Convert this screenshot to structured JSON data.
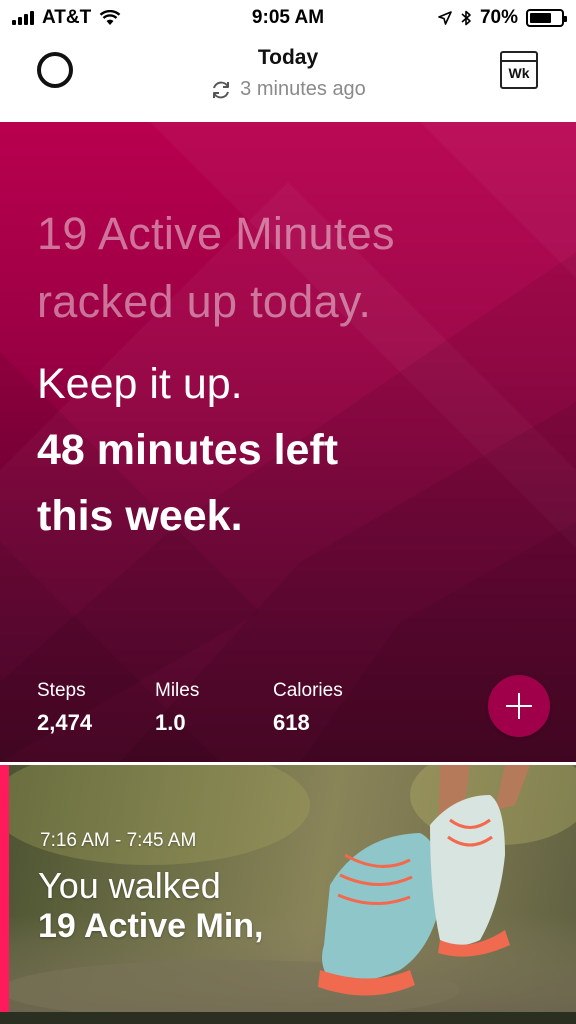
{
  "status_bar": {
    "carrier": "AT&T",
    "time": "9:05 AM",
    "battery": "70%",
    "battery_level": 0.7,
    "icons": [
      "signal-icon",
      "wifi-icon",
      "location-icon",
      "bluetooth-icon",
      "battery-icon"
    ]
  },
  "header": {
    "title": "Today",
    "sync_text": "3 minutes ago",
    "week_button": "Wk"
  },
  "hero": {
    "line1": "19 Active Minutes",
    "line2": "racked up today.",
    "encourage": "Keep it up.",
    "bold_line1": "48 minutes left",
    "bold_line2": "this week."
  },
  "stats": [
    {
      "label": "Steps",
      "value": "2,474"
    },
    {
      "label": "Miles",
      "value": "1.0"
    },
    {
      "label": "Calories",
      "value": "618"
    }
  ],
  "activity": {
    "time_range": "7:16 AM - 7:45 AM",
    "title": "You walked",
    "detail": "19 Active Min,"
  },
  "colors": {
    "hero_top": "#b8004f",
    "hero_bottom": "#4a0024",
    "accent": "#ff1a5c",
    "plus_button": "#a0004a"
  }
}
